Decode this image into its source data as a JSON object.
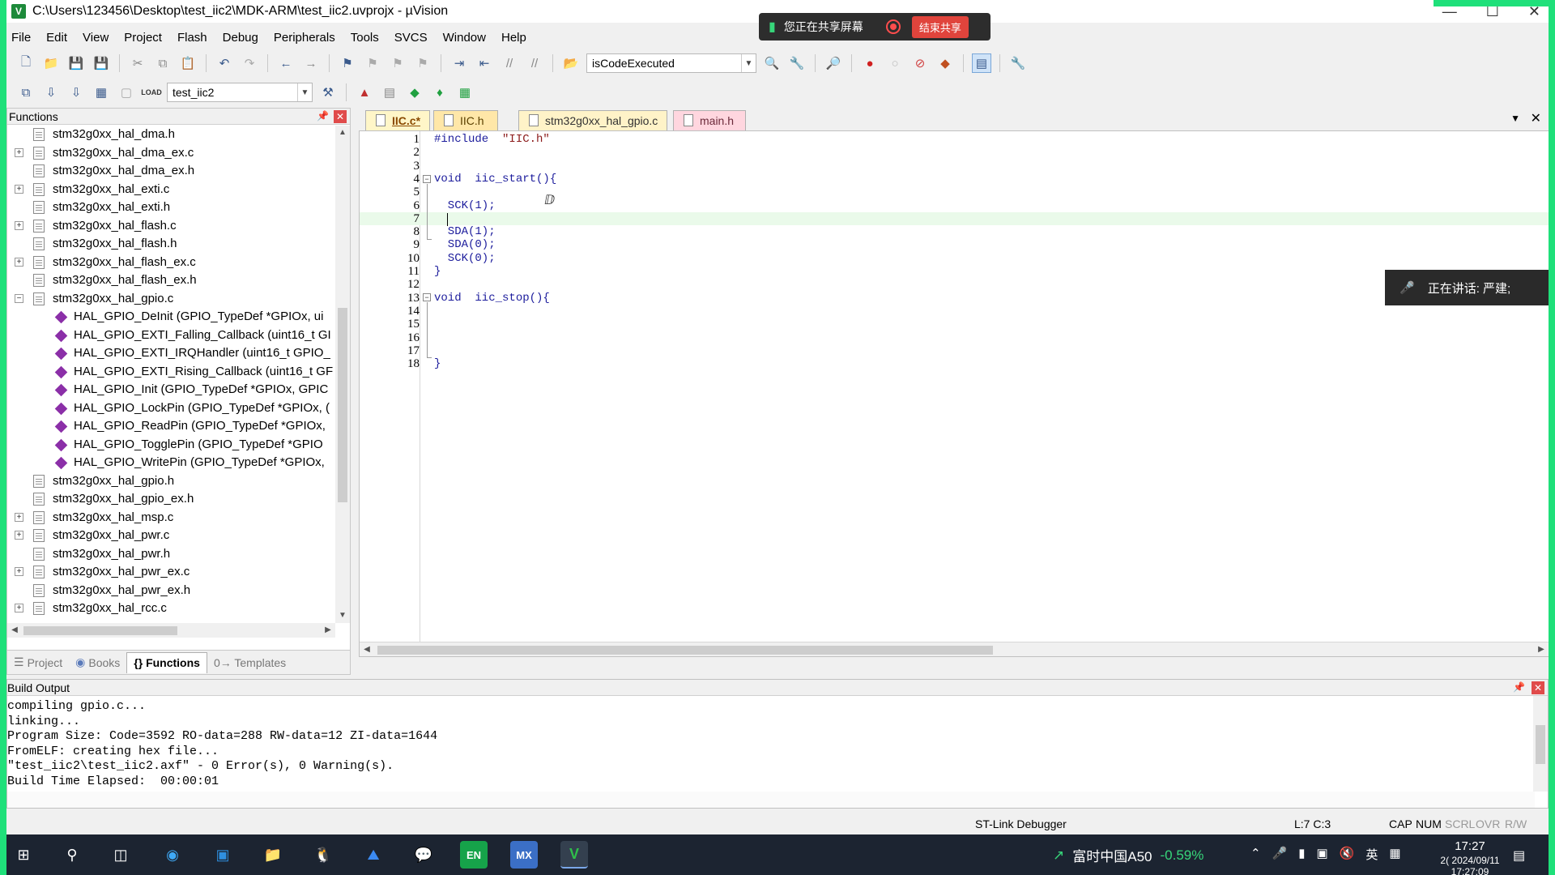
{
  "window": {
    "title": "C:\\Users\\123456\\Desktop\\test_iic2\\MDK-ARM\\test_iic2.uvprojx - µVision",
    "icon": "V"
  },
  "share_bar": {
    "text": "您正在共享屏幕",
    "end_label": "结束共享"
  },
  "menu": [
    "File",
    "Edit",
    "View",
    "Project",
    "Flash",
    "Debug",
    "Peripherals",
    "Tools",
    "SVCS",
    "Window",
    "Help"
  ],
  "toolbar": {
    "find_combo_value": "isCodeExecuted",
    "target_combo_value": "test_iic2",
    "load_label": "LOAD"
  },
  "functions_panel": {
    "title": "Functions",
    "tree": [
      {
        "label": "stm32g0xx_hal_dma.h",
        "type": "file",
        "expander": "",
        "indent": 0
      },
      {
        "label": "stm32g0xx_hal_dma_ex.c",
        "type": "file",
        "expander": "+",
        "indent": 0
      },
      {
        "label": "stm32g0xx_hal_dma_ex.h",
        "type": "file",
        "expander": "",
        "indent": 0
      },
      {
        "label": "stm32g0xx_hal_exti.c",
        "type": "file",
        "expander": "+",
        "indent": 0
      },
      {
        "label": "stm32g0xx_hal_exti.h",
        "type": "file",
        "expander": "",
        "indent": 0
      },
      {
        "label": "stm32g0xx_hal_flash.c",
        "type": "file",
        "expander": "+",
        "indent": 0
      },
      {
        "label": "stm32g0xx_hal_flash.h",
        "type": "file",
        "expander": "",
        "indent": 0
      },
      {
        "label": "stm32g0xx_hal_flash_ex.c",
        "type": "file",
        "expander": "+",
        "indent": 0
      },
      {
        "label": "stm32g0xx_hal_flash_ex.h",
        "type": "file",
        "expander": "",
        "indent": 0
      },
      {
        "label": "stm32g0xx_hal_gpio.c",
        "type": "file",
        "expander": "-",
        "indent": 0
      },
      {
        "label": "HAL_GPIO_DeInit (GPIO_TypeDef *GPIOx, ui",
        "type": "function",
        "expander": "",
        "indent": 1
      },
      {
        "label": "HAL_GPIO_EXTI_Falling_Callback (uint16_t GI",
        "type": "function",
        "expander": "",
        "indent": 1
      },
      {
        "label": "HAL_GPIO_EXTI_IRQHandler (uint16_t GPIO_",
        "type": "function",
        "expander": "",
        "indent": 1
      },
      {
        "label": "HAL_GPIO_EXTI_Rising_Callback (uint16_t GF",
        "type": "function",
        "expander": "",
        "indent": 1
      },
      {
        "label": "HAL_GPIO_Init (GPIO_TypeDef *GPIOx, GPIC",
        "type": "function",
        "expander": "",
        "indent": 1
      },
      {
        "label": "HAL_GPIO_LockPin (GPIO_TypeDef *GPIOx, (",
        "type": "function",
        "expander": "",
        "indent": 1
      },
      {
        "label": "HAL_GPIO_ReadPin (GPIO_TypeDef *GPIOx,",
        "type": "function",
        "expander": "",
        "indent": 1
      },
      {
        "label": "HAL_GPIO_TogglePin (GPIO_TypeDef *GPIO",
        "type": "function",
        "expander": "",
        "indent": 1
      },
      {
        "label": "HAL_GPIO_WritePin (GPIO_TypeDef *GPIOx,",
        "type": "function",
        "expander": "",
        "indent": 1
      },
      {
        "label": "stm32g0xx_hal_gpio.h",
        "type": "file",
        "expander": "",
        "indent": 0
      },
      {
        "label": "stm32g0xx_hal_gpio_ex.h",
        "type": "file",
        "expander": "",
        "indent": 0
      },
      {
        "label": "stm32g0xx_hal_msp.c",
        "type": "file",
        "expander": "+",
        "indent": 0
      },
      {
        "label": "stm32g0xx_hal_pwr.c",
        "type": "file",
        "expander": "+",
        "indent": 0
      },
      {
        "label": "stm32g0xx_hal_pwr.h",
        "type": "file",
        "expander": "",
        "indent": 0
      },
      {
        "label": "stm32g0xx_hal_pwr_ex.c",
        "type": "file",
        "expander": "+",
        "indent": 0
      },
      {
        "label": "stm32g0xx_hal_pwr_ex.h",
        "type": "file",
        "expander": "",
        "indent": 0
      },
      {
        "label": "stm32g0xx_hal_rcc.c",
        "type": "file",
        "expander": "+",
        "indent": 0
      }
    ],
    "tabs": [
      {
        "label": "Project",
        "active": false
      },
      {
        "label": "Books",
        "active": false
      },
      {
        "label": "{} Functions",
        "active": true
      },
      {
        "label": "0→ Templates",
        "active": false
      }
    ]
  },
  "editor": {
    "tabs": [
      {
        "label": "IIC.c*",
        "active": true
      },
      {
        "label": "IIC.h",
        "active": false
      },
      {
        "label": "stm32g0xx_hal_gpio.c",
        "active": false
      },
      {
        "label": "main.h",
        "active": false
      }
    ],
    "current_line": 7,
    "lines": [
      {
        "n": "1",
        "text": "#include  \"IIC.h\""
      },
      {
        "n": "2",
        "text": ""
      },
      {
        "n": "3",
        "text": ""
      },
      {
        "n": "4",
        "text": "void  iic_start(){"
      },
      {
        "n": "5",
        "text": ""
      },
      {
        "n": "6",
        "text": "  SCK(1);"
      },
      {
        "n": "7",
        "text": ""
      },
      {
        "n": "8",
        "text": "  SDA(1);"
      },
      {
        "n": "9",
        "text": "  SDA(0);"
      },
      {
        "n": "10",
        "text": "  SCK(0);"
      },
      {
        "n": "11",
        "text": "}"
      },
      {
        "n": "12",
        "text": ""
      },
      {
        "n": "13",
        "text": "void  iic_stop(){"
      },
      {
        "n": "14",
        "text": ""
      },
      {
        "n": "15",
        "text": ""
      },
      {
        "n": "16",
        "text": ""
      },
      {
        "n": "17",
        "text": ""
      },
      {
        "n": "18",
        "text": "}"
      }
    ]
  },
  "speaking_popup": {
    "text": "正在讲话:  严建;"
  },
  "build_output": {
    "title": "Build Output",
    "lines": [
      "compiling gpio.c...",
      "linking...",
      "Program Size: Code=3592 RO-data=288 RW-data=12 ZI-data=1644",
      "FromELF: creating hex file...",
      "\"test_iic2\\test_iic2.axf\" - 0 Error(s), 0 Warning(s).",
      "Build Time Elapsed:  00:00:01"
    ]
  },
  "status_bar": {
    "debugger": "ST-Link Debugger",
    "position": "L:7 C:3",
    "cap": "CAP",
    "num": "NUM",
    "scrl": "SCRL",
    "ovr": "OVR",
    "rw": "R/W"
  },
  "taskbar": {
    "stock_name": "富时中国A50",
    "stock_change": "-0.59%",
    "ime": "英",
    "time": "17:27",
    "date": "2( 2024/09/11 17:27:09"
  }
}
